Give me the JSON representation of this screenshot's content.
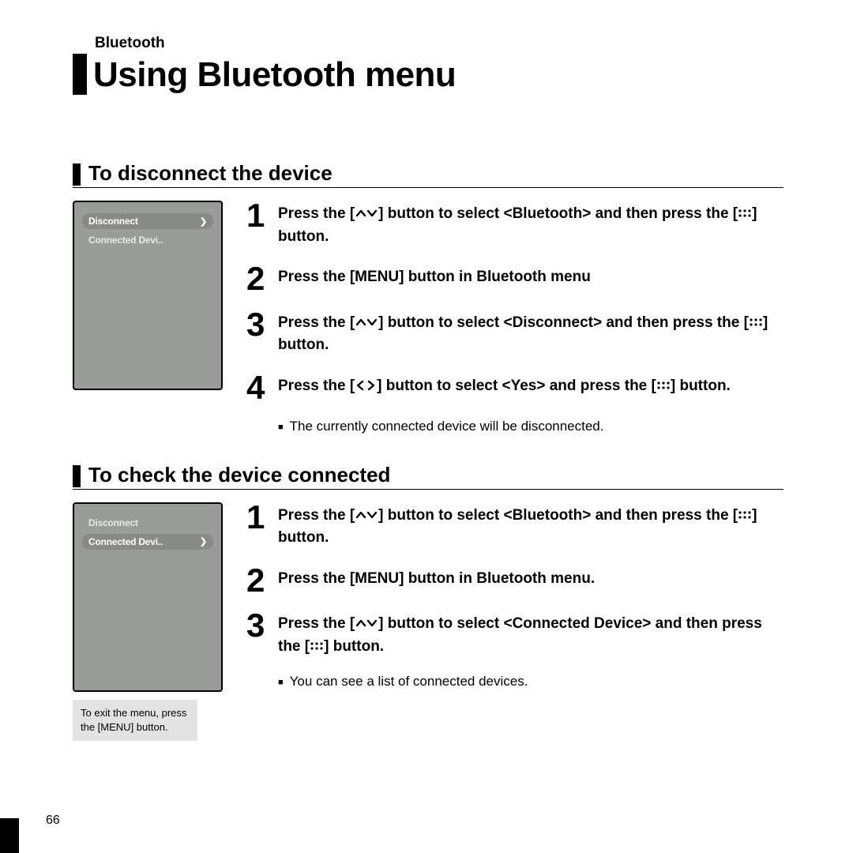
{
  "breadcrumb": "Bluetooth",
  "title": "Using Bluetooth menu",
  "page_number": "66",
  "tip": "To exit the menu, press the [MENU] button.",
  "icons": {
    "grid": "grid-6-dots",
    "updown": "up-down-carets",
    "leftright": "left-right-carets"
  },
  "sections": [
    {
      "heading": "To disconnect the device",
      "device_menu": {
        "selected_index": 0,
        "items": [
          {
            "label": "Disconnect",
            "has_chevron": true
          },
          {
            "label": "Connected Devi..",
            "has_chevron": false
          }
        ]
      },
      "steps": [
        {
          "n": "1",
          "parts": [
            "Press the [",
            "updown",
            "] button to select <Bluetooth> and then press the [",
            "grid",
            "] button."
          ]
        },
        {
          "n": "2",
          "parts": [
            "Press the [MENU] button in Bluetooth menu"
          ]
        },
        {
          "n": "3",
          "parts": [
            "Press the [",
            "updown",
            "] button to select <Disconnect> and then press the [",
            "grid",
            "] button."
          ]
        },
        {
          "n": "4",
          "parts": [
            "Press the [",
            "leftright",
            "] button to select <Yes> and press the [",
            "grid",
            "] button."
          ]
        }
      ],
      "notes": [
        "The currently connected device will be disconnected."
      ]
    },
    {
      "heading": "To check the device connected",
      "device_menu": {
        "selected_index": 1,
        "items": [
          {
            "label": "Disconnect",
            "has_chevron": false
          },
          {
            "label": "Connected Devi..",
            "has_chevron": true
          }
        ]
      },
      "steps": [
        {
          "n": "1",
          "parts": [
            "Press the [",
            "updown",
            "] button to select <Bluetooth> and then press the [",
            "grid",
            "] button."
          ]
        },
        {
          "n": "2",
          "parts": [
            "Press the [MENU] button in Bluetooth menu."
          ]
        },
        {
          "n": "3",
          "parts": [
            "Press the [",
            "updown",
            "] button to select <Connected Device> and then press the [",
            "grid",
            "] button."
          ]
        }
      ],
      "notes": [
        "You can see a list of connected devices."
      ]
    }
  ]
}
